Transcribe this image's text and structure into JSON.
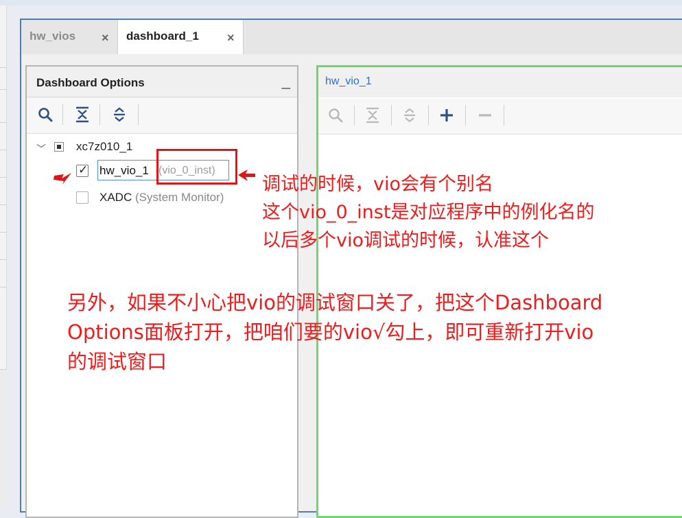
{
  "tabs": [
    {
      "label": "hw_vios",
      "close": "×",
      "active": false
    },
    {
      "label": "dashboard_1",
      "close": "×",
      "active": true
    }
  ],
  "dashboard": {
    "title": "Dashboard Options",
    "minimize": "_",
    "tree": {
      "device": "xc7z010_1",
      "items": [
        {
          "label": "hw_vio_1",
          "alias": "(vio_0_inst)",
          "checked": true
        },
        {
          "label": "XADC",
          "alias": "(System Monitor)",
          "checked": false
        }
      ]
    }
  },
  "vio_panel": {
    "title": "hw_vio_1"
  },
  "annotations": {
    "note1": [
      "调试的时候，vio会有个别名",
      "这个vio_0_inst是对应程序中的例化名的",
      "以后多个vio调试的时候，认准这个"
    ],
    "note2": [
      "另外，如果不小心把vio的调试窗口关了，把这个Dashboard",
      "Options面板打开，把咱们要的vio√勾上，即可重新打开vio",
      "的调试窗口"
    ],
    "color": "#ee1c1c"
  },
  "colors": {
    "window_border": "#4c7bc6",
    "vio_panel_border": "#6ed86e",
    "link_blue": "#2b6fd1"
  }
}
